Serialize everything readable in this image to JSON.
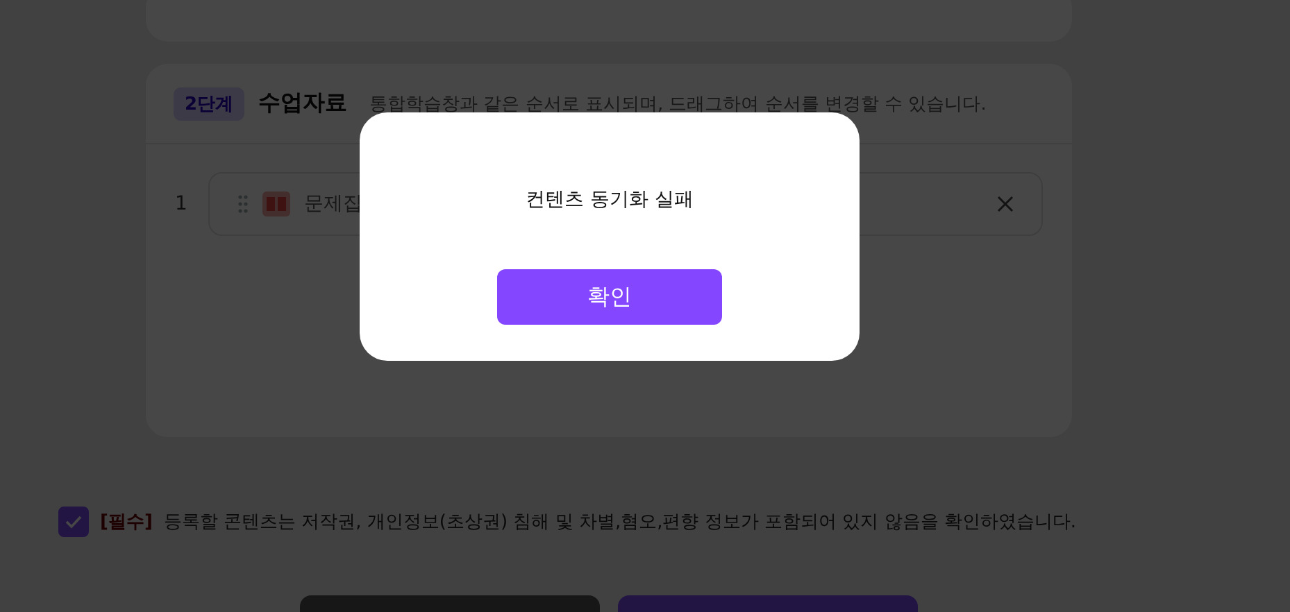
{
  "step": {
    "badge": "2단계",
    "title": "수업자료",
    "description": "통합학습창과 같은 순서로 표시되며, 드래그하여 순서를 변경할 수 있습니다."
  },
  "materials": [
    {
      "number": "1",
      "name": "문제집"
    }
  ],
  "agreement": {
    "checked": true,
    "required_tag": "[필수]",
    "text": "등록할 콘텐츠는 저작권, 개인정보(초상권) 침해 및 차별,혐오,편향 정보가 포함되어 있지 않음을 확인하였습니다."
  },
  "dialog": {
    "message": "컨텐츠 동기화 실패",
    "confirm": "확인"
  }
}
